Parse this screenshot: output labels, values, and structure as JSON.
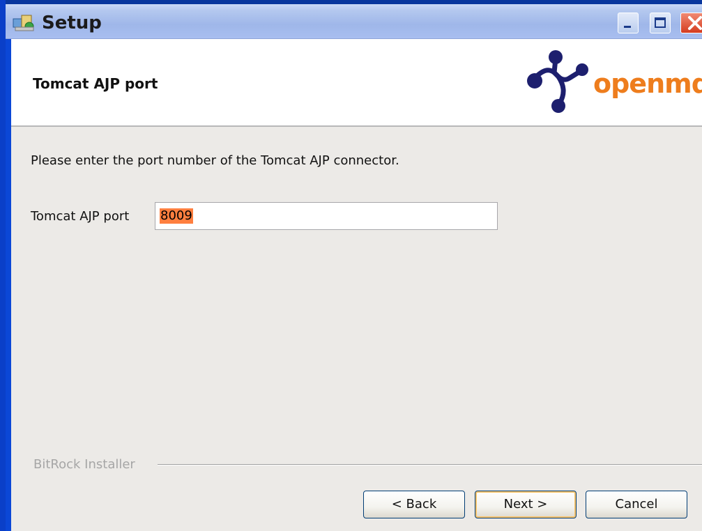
{
  "window": {
    "title": "Setup",
    "controls": {
      "minimize": "minimize",
      "maximize": "maximize",
      "close": "close"
    }
  },
  "header": {
    "title": "Tomcat AJP port",
    "logo_text": "openmdx"
  },
  "content": {
    "description": "Please enter the port number of the Tomcat AJP connector.",
    "port_field": {
      "label": "Tomcat AJP port",
      "value": "8009"
    }
  },
  "footer": {
    "branding": "BitRock Installer",
    "buttons": {
      "back": "< Back",
      "next": "Next >",
      "cancel": "Cancel"
    }
  },
  "colors": {
    "accent_orange": "#ee7d1d",
    "logo_blue": "#1d1f6e",
    "selection": "#ff7f3f"
  }
}
